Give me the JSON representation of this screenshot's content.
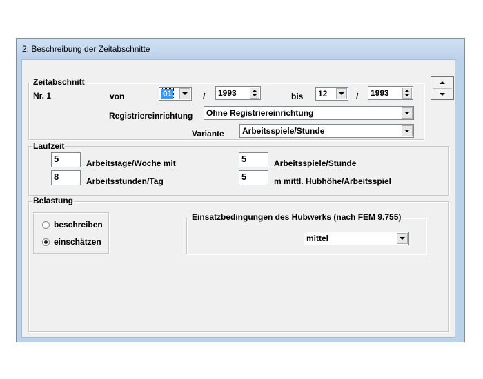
{
  "window": {
    "title": "2. Beschreibung der Zeitabschnitte"
  },
  "zeitabschnitt": {
    "legend": "Zeitabschnitt",
    "nr_label": "Nr. 1",
    "von_label": "von",
    "von_month": "01",
    "separator": "/",
    "von_year": "1993",
    "bis_label": "bis",
    "bis_month": "12",
    "bis_year": "1993",
    "registrier_label": "Registriereinrichtung",
    "registrier_value": "Ohne Registriereinrichtung",
    "variante_label": "Variante",
    "variante_value": "Arbeitsspiele/Stunde"
  },
  "laufzeit": {
    "legend": "Laufzeit",
    "tage_value": "5",
    "tage_label": "Arbeitstage/Woche mit",
    "stunden_value": "8",
    "stunden_label": "Arbeitsstunden/Tag",
    "spiele_value": "5",
    "spiele_label": "Arbeitsspiele/Stunde",
    "hub_value": "5",
    "hub_label": "m mittl. Hubhöhe/Arbeitsspiel"
  },
  "belastung": {
    "legend": "Belastung",
    "option_beschreiben": "beschreiben",
    "option_einschaetzen": "einschätzen",
    "selected": "einschätzen",
    "einsatz_legend": "Einsatzbedingungen des Hubwerks (nach FEM 9.755)",
    "einsatz_value": "mittel"
  }
}
